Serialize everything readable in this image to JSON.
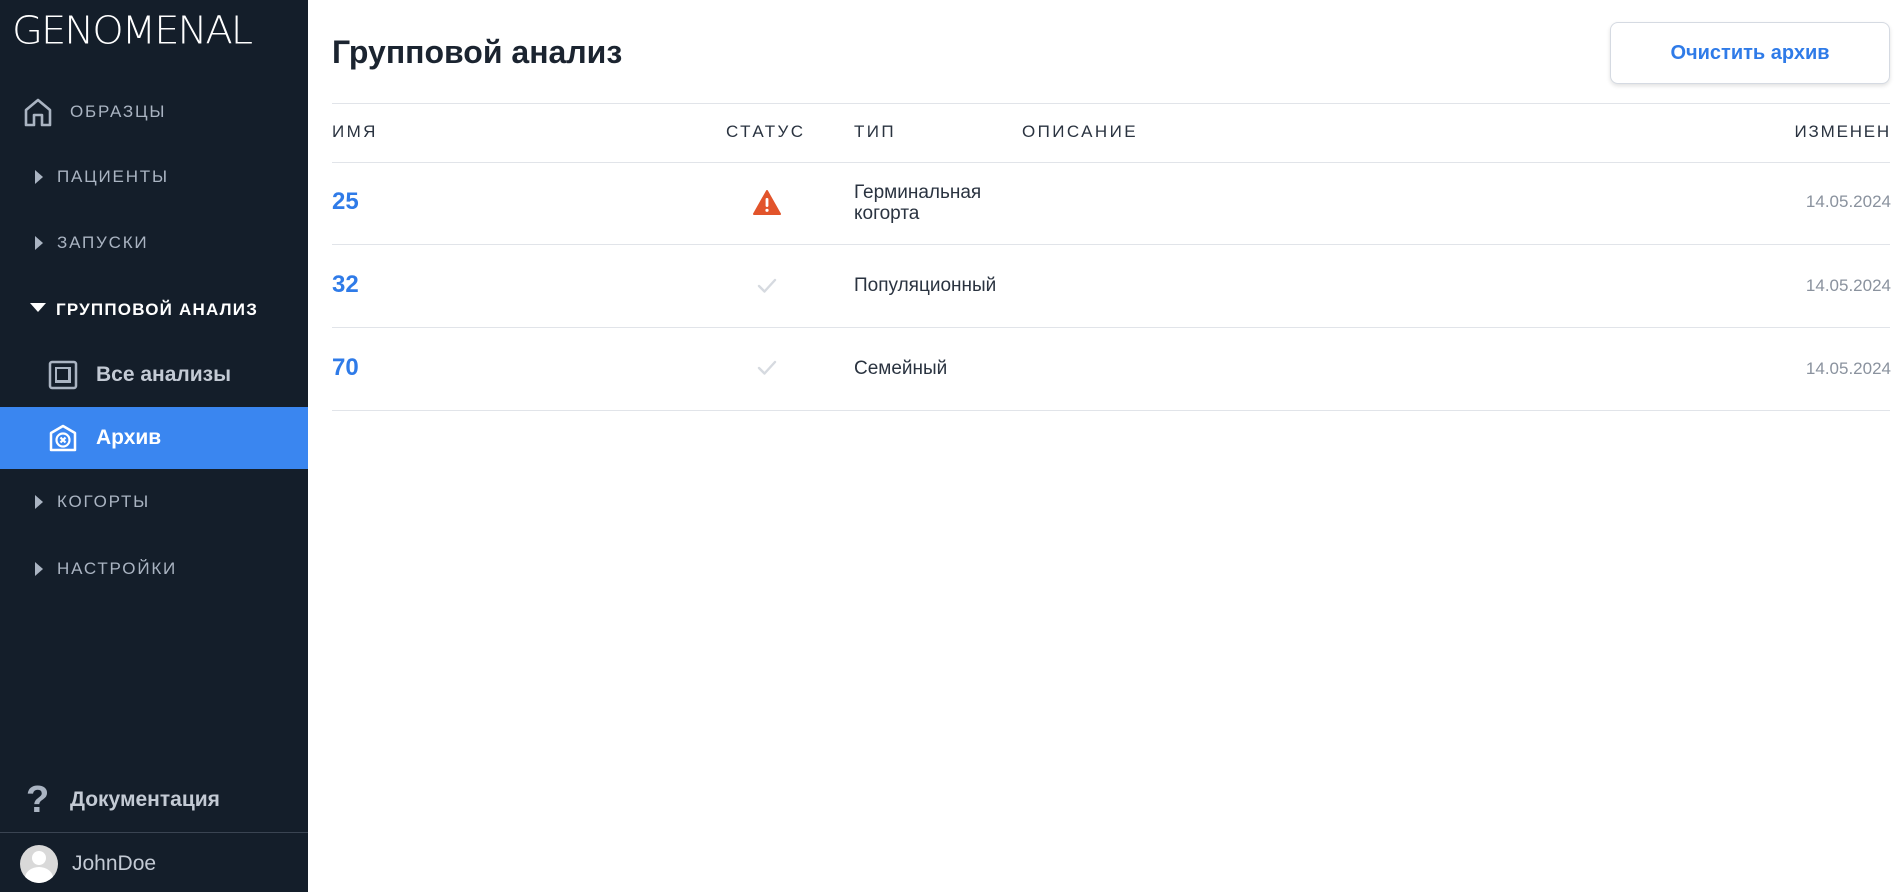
{
  "app": {
    "logo": "GENOMENAL"
  },
  "sidebar": {
    "items": [
      {
        "label": "ОБРАЗЦЫ",
        "icon": "home-icon"
      },
      {
        "label": "ПАЦИЕНТЫ",
        "icon": "caret-right-icon"
      },
      {
        "label": "ЗАПУСКИ",
        "icon": "caret-right-icon"
      },
      {
        "label": "ГРУППОВОЙ АНАЛИЗ",
        "icon": "caret-down-icon",
        "expanded": true
      },
      {
        "label": "КОГОРТЫ",
        "icon": "caret-right-icon"
      },
      {
        "label": "НАСТРОЙКИ",
        "icon": "caret-right-icon"
      }
    ],
    "subitems": [
      {
        "label": "Все анализы",
        "icon": "stacked-squares-icon"
      },
      {
        "label": "Архив",
        "icon": "archive-x-icon",
        "active": true
      }
    ],
    "docs_label": "Документация",
    "docs_icon": "question-icon",
    "user_name": "JohnDoe",
    "active_color": "#3a86f0",
    "background_color": "#141e2a"
  },
  "main": {
    "title": "Групповой анализ",
    "clear_button": "Очистить архив",
    "columns": {
      "name": "ИМЯ",
      "status": "СТАТУС",
      "type": "ТИП",
      "description": "ОПИСАНИЕ",
      "modified": "ИЗМЕНЕН"
    },
    "rows": [
      {
        "name": "25",
        "status": "warning",
        "status_icon": "warning-triangle-icon",
        "type_line1": "Герминальная",
        "type_line2": "когорта",
        "description": "",
        "modified": "14.05.2024"
      },
      {
        "name": "32",
        "status": "ok",
        "status_icon": "check-icon",
        "type_line1": "Популяционный",
        "type_line2": "",
        "description": "",
        "modified": "14.05.2024"
      },
      {
        "name": "70",
        "status": "ok",
        "status_icon": "check-icon",
        "type_line1": "Семейный",
        "type_line2": "",
        "description": "",
        "modified": "14.05.2024"
      }
    ],
    "accent_color": "#2f7be8",
    "warning_color": "#e2542b"
  }
}
